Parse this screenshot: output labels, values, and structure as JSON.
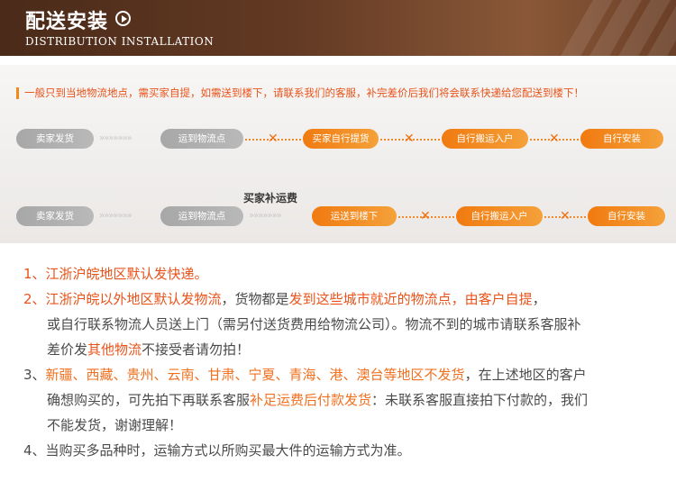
{
  "header": {
    "title": "配送安装",
    "subtitle": "DISTRIBUTION INSTALLATION"
  },
  "notice": "一般只到当地物流地点，需买家自提，如需送到楼下，请联系我们的客服，补完差价后我们将会联系快递给您配送到楼下！",
  "flow1": {
    "steps": [
      "卖家发货",
      "运到物流点",
      "买家自行提货",
      "自行搬运入户",
      "自行安装"
    ]
  },
  "flow2": {
    "extra_label": "买家补运费",
    "steps": [
      "卖家发货",
      "运到物流点",
      "运送到楼下",
      "自行搬运入户",
      "自行安装"
    ]
  },
  "chevrons": "»»»»»»»",
  "rules": {
    "r1": "1、江浙沪皖地区默认发快递。",
    "r2_a": "2、江浙沪皖以外地区默认发物流",
    "r2_b": "，货物都是",
    "r2_c": "发到这些城市就近的物流点，由客户自提",
    "r2_d": "，",
    "r2_line2": "或自行联系物流人员送上门（需另付送货费用给物流公司）。物流不到的城市请联系客服补",
    "r2_line3_a": "差价发",
    "r2_line3_b": "其他物流",
    "r2_line3_c": "不接受者请勿拍！",
    "r3_num": "3、",
    "r3_a": "新疆、西藏、贵州、云南、甘肃、宁夏、青海、港、澳台等地区不发货",
    "r3_b": "，在上述地区的客户",
    "r3_line2_a": "确想购买的，可先拍下再联系客服",
    "r3_line2_b": "补足运费后付款发货",
    "r3_line2_c": "：未联系客服直接拍下付款的，我们",
    "r3_line3": "不能发货，谢谢理解！",
    "r4": "4、当购买多品种时，运输方式以所购买最大件的运输方式为准。"
  },
  "colors": {
    "accent": "#e8531a",
    "orange_pill": "#f5921e",
    "gray_pill": "#b0b0b0",
    "header_brown": "#5a341f"
  }
}
